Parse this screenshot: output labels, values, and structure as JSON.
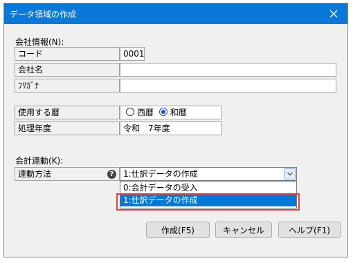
{
  "window": {
    "title": "データ領域の作成"
  },
  "company_info": {
    "label": "会社情報(N):",
    "rows": [
      {
        "label": "コード",
        "value": "0001"
      },
      {
        "label": "会社名",
        "value": ""
      },
      {
        "label": "ﾌﾘｶﾞﾅ",
        "value": ""
      }
    ]
  },
  "calendar": {
    "label": "使用する暦",
    "options": [
      "西暦",
      "和暦"
    ],
    "selected": "和暦"
  },
  "fiscal_year": {
    "label": "処理年度",
    "value": "令和　7年度"
  },
  "accounting_link": {
    "label": "会計連動(K):",
    "method_label": "連動方法",
    "selected_value": "1:仕訳データの作成",
    "options": [
      "0:会計データの受入",
      "1:仕訳データの作成"
    ],
    "highlighted_option": "1:仕訳データの作成"
  },
  "buttons": {
    "create": "作成(F5)",
    "cancel": "キャンセル",
    "help": "ヘルプ(F1)"
  },
  "colors": {
    "titlebar": "#0a78d7",
    "highlight": "#0078d7",
    "callout": "#e04141"
  }
}
